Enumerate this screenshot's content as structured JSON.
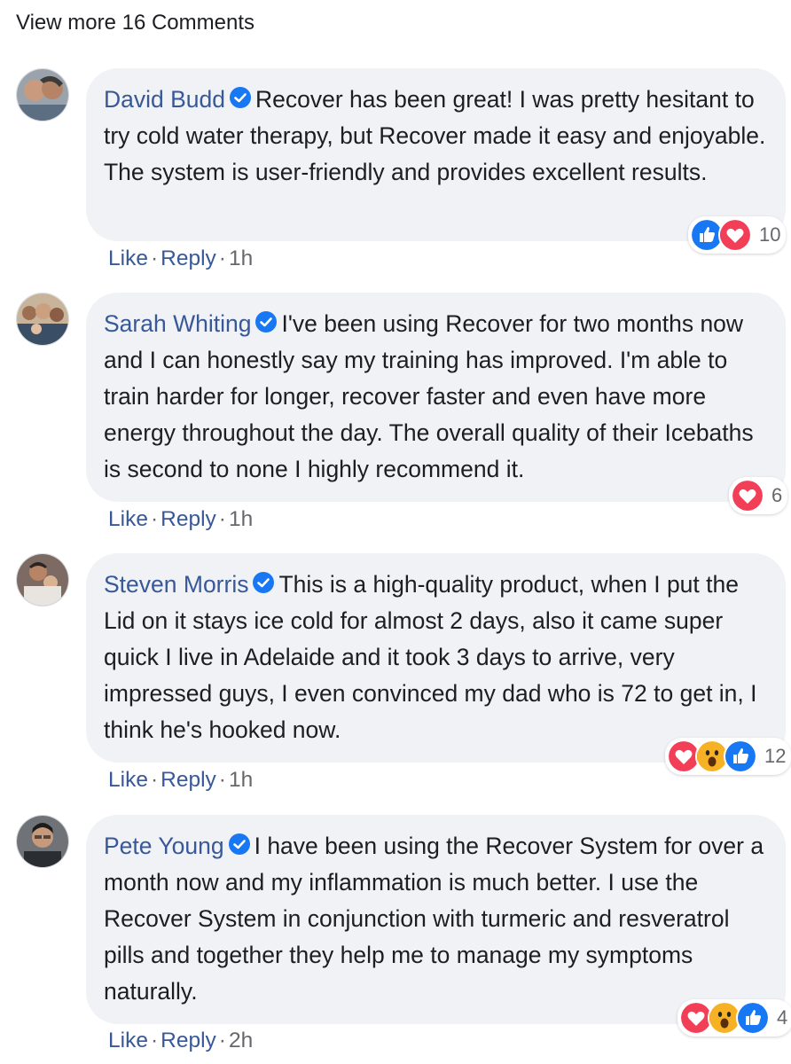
{
  "view_more_label": "View more 16 Comments",
  "colors": {
    "link": "#385898",
    "bubble": "#f0f2f5",
    "like_blue": "#1877f2",
    "love_red": "#f33e58",
    "wow_yellow": "#f7b125"
  },
  "comments": [
    {
      "author": "David Budd",
      "text": "Recover has been great! I was pretty hesitant to try cold water therapy, but Recover made it easy and enjoyable. The system is user-friendly and provides excellent results.",
      "reactions": [
        "like-icon",
        "love-icon"
      ],
      "reaction_count": "10",
      "like": "Like",
      "reply": "Reply",
      "dot": "·",
      "time": "1h"
    },
    {
      "author": "Sarah Whiting",
      "text": "I've been using Recover for two months now and I can honestly say my training has improved. I'm able to train harder for longer, recover faster and even have more energy throughout the day. The overall quality of their Icebaths is second to none I highly recommend it.",
      "reactions": [
        "love-icon"
      ],
      "reaction_count": "6",
      "like": "Like",
      "reply": "Reply",
      "dot": "·",
      "time": "1h"
    },
    {
      "author": "Steven Morris",
      "text": "This is a high-quality product, when I put the Lid on it stays ice cold for almost 2 days, also it came super quick I live in Adelaide and it took 3 days to arrive, very impressed guys, I even convinced my dad who is 72 to get in, I think he's hooked now.",
      "reactions": [
        "love-icon",
        "wow-icon",
        "like-icon"
      ],
      "reaction_count": "12",
      "like": "Like",
      "reply": "Reply",
      "dot": "·",
      "time": "1h"
    },
    {
      "author": "Pete Young",
      "text": "I have been using the Recover System for over a month now and my inflammation is much better. I use the Recover System in conjunction with turmeric and resveratrol pills and together they help me to manage my symptoms naturally.",
      "reactions": [
        "love-icon",
        "wow-icon",
        "like-icon"
      ],
      "reaction_count": "4",
      "like": "Like",
      "reply": "Reply",
      "dot": "·",
      "time": "2h"
    }
  ]
}
